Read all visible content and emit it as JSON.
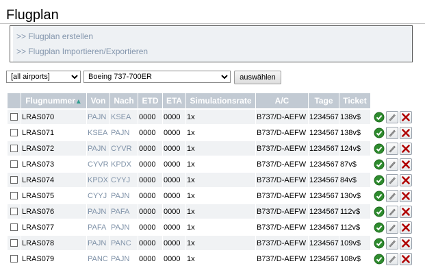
{
  "page": {
    "title": "Flugplan"
  },
  "menu": {
    "items": [
      {
        "label": ">> Flugplan erstellen"
      },
      {
        "label": ">> Flugplan Importieren/Exportieren"
      }
    ]
  },
  "filters": {
    "airport_select": {
      "value": "[all airports]"
    },
    "aircraft_select": {
      "value": "Boeing 737-700ER"
    },
    "submit_label": "auswählen"
  },
  "table": {
    "columns": [
      "Flugnummer",
      "Von",
      "Nach",
      "ETD",
      "ETA",
      "Simulationsrate",
      "A/C",
      "Tage",
      "Ticket"
    ],
    "sort_indicator": "▲",
    "rows": [
      {
        "flight": "LRAS070",
        "from": "PAJN",
        "to": "KSEA",
        "etd": "0000",
        "eta": "0000",
        "rate": "1x",
        "ac": "B737/D-AEFW",
        "days": "1234567",
        "ticket": "138v$"
      },
      {
        "flight": "LRAS071",
        "from": "KSEA",
        "to": "PAJN",
        "etd": "0000",
        "eta": "0000",
        "rate": "1x",
        "ac": "B737/D-AEFW",
        "days": "1234567",
        "ticket": "138v$"
      },
      {
        "flight": "LRAS072",
        "from": "PAJN",
        "to": "CYVR",
        "etd": "0000",
        "eta": "0000",
        "rate": "1x",
        "ac": "B737/D-AEFW",
        "days": "1234567",
        "ticket": "124v$"
      },
      {
        "flight": "LRAS073",
        "from": "CYVR",
        "to": "KPDX",
        "etd": "0000",
        "eta": "0000",
        "rate": "1x",
        "ac": "B737/D-AEFW",
        "days": "1234567",
        "ticket": "87v$"
      },
      {
        "flight": "LRAS074",
        "from": "KPDX",
        "to": "CYYJ",
        "etd": "0000",
        "eta": "0000",
        "rate": "1x",
        "ac": "B737/D-AEFW",
        "days": "1234567",
        "ticket": "84v$"
      },
      {
        "flight": "LRAS075",
        "from": "CYYJ",
        "to": "PAJN",
        "etd": "0000",
        "eta": "0000",
        "rate": "1x",
        "ac": "B737/D-AEFW",
        "days": "1234567",
        "ticket": "130v$"
      },
      {
        "flight": "LRAS076",
        "from": "PAJN",
        "to": "PAFA",
        "etd": "0000",
        "eta": "0000",
        "rate": "1x",
        "ac": "B737/D-AEFW",
        "days": "1234567",
        "ticket": "112v$"
      },
      {
        "flight": "LRAS077",
        "from": "PAFA",
        "to": "PAJN",
        "etd": "0000",
        "eta": "0000",
        "rate": "1x",
        "ac": "B737/D-AEFW",
        "days": "1234567",
        "ticket": "112v$"
      },
      {
        "flight": "LRAS078",
        "from": "PAJN",
        "to": "PANC",
        "etd": "0000",
        "eta": "0000",
        "rate": "1x",
        "ac": "B737/D-AEFW",
        "days": "1234567",
        "ticket": "109v$"
      },
      {
        "flight": "LRAS079",
        "from": "PANC",
        "to": "PAJN",
        "etd": "0000",
        "eta": "0000",
        "rate": "1x",
        "ac": "B737/D-AEFW",
        "days": "1234567",
        "ticket": "108v$"
      }
    ],
    "row_icons": [
      "check-icon",
      "edit-icon",
      "delete-icon"
    ]
  },
  "colors": {
    "header_bg": "#c2cad3",
    "row_alt_bg": "#f0f2f4",
    "link": "#8496ad",
    "airport_text": "#7f92a8",
    "check_green": "#2e8b2e",
    "delete_red": "#b00000"
  }
}
